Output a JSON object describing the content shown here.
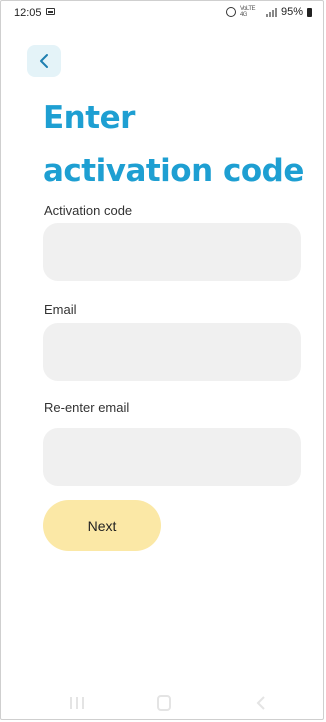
{
  "status_bar": {
    "time": "12:05",
    "network_label": "VoLTE 4G",
    "battery": "95%"
  },
  "header": {
    "title_line1": "Enter",
    "title_line2": "activation code"
  },
  "form": {
    "activation_code": {
      "label": "Activation code",
      "value": "",
      "placeholder": ""
    },
    "email": {
      "label": "Email",
      "value": "",
      "placeholder": ""
    },
    "reenter_email": {
      "label": "Re-enter email",
      "value": "",
      "placeholder": ""
    },
    "next_label": "Next"
  },
  "colors": {
    "title": "#1e9fd2",
    "back_button_bg": "#e4f3f8",
    "input_bg": "#f0f0f0",
    "next_button_bg": "#fbe8a6"
  },
  "icons": {
    "back": "chevron-left-icon",
    "alarm": "alarm-icon",
    "signal": "signal-icon",
    "battery": "battery-icon",
    "nav_recents": "recents-icon",
    "nav_home": "home-icon",
    "nav_back": "back-icon"
  }
}
